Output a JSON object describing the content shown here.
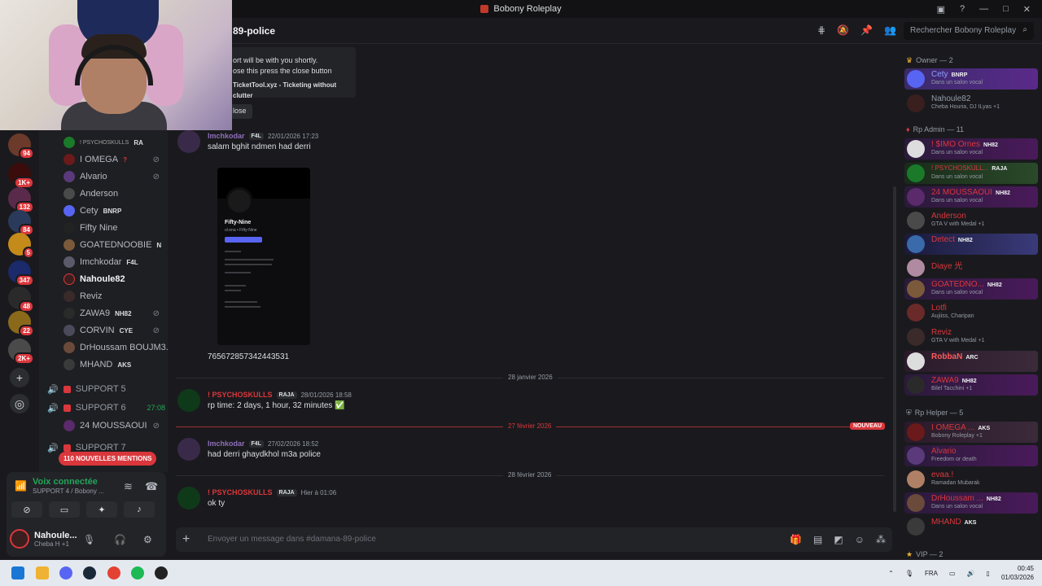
{
  "window": {
    "title": "Bobony Roleplay",
    "controls": [
      "—",
      "□",
      "✕"
    ]
  },
  "header": {
    "channel_name": "89-police",
    "search_placeholder": "Rechercher Bobony Roleplay"
  },
  "servers": {
    "badges": [
      "94",
      "1K+",
      "132",
      "84",
      "5",
      "347",
      "48",
      "22",
      "2K+"
    ]
  },
  "voice_users": [
    {
      "name": "! PSYCHOSKULLS",
      "color": "#a0a0a0",
      "tag": "RA"
    },
    {
      "name": "I OMEGA",
      "color": "#b5bac1",
      "tag": "?"
    },
    {
      "name": "Alvario",
      "color": "#b5bac1",
      "tag": ""
    },
    {
      "name": "Anderson",
      "color": "#b5bac1",
      "tag": ""
    },
    {
      "name": "Cety",
      "color": "#b5bac1",
      "tag": "BNRP"
    },
    {
      "name": "Fifty Nine",
      "color": "#b5bac1",
      "tag": ""
    },
    {
      "name": "GOATEDNOOBIE",
      "color": "#b5bac1",
      "tag": "N"
    },
    {
      "name": "Imchkodar",
      "color": "#b5bac1",
      "tag": "F4L"
    },
    {
      "name": "Nahoule82",
      "color": "#f2f3f5",
      "tag": ""
    },
    {
      "name": "Reviz",
      "color": "#b5bac1",
      "tag": ""
    },
    {
      "name": "ZAWA9",
      "color": "#b5bac1",
      "tag": "NH82"
    },
    {
      "name": "CORVIN",
      "color": "#b5bac1",
      "tag": "CYE"
    },
    {
      "name": "DrHoussam BOUJM3...",
      "color": "#b5bac1",
      "tag": ""
    },
    {
      "name": "MHAND",
      "color": "#b5bac1",
      "tag": "AKS"
    }
  ],
  "voice_channels": [
    {
      "name": "SUPPORT 5",
      "timer": ""
    },
    {
      "name": "SUPPORT 6",
      "timer": "27:08"
    },
    {
      "name": "SUPPORT 7",
      "timer": ""
    }
  ],
  "support6_user": "24 MOUSSAOUI",
  "mentions_label": "110 NOUVELLES MENTIONS",
  "voice_panel": {
    "title": "Voix connectée",
    "subtitle": "SUPPORT 4 / Bobony ...",
    "user_name": "Nahoule...",
    "user_status": "Cheba H +1"
  },
  "embed": {
    "line1": "ort will be with you shortly.",
    "line2": "ose this press the close button",
    "footer": "TicketTool.xyz - Ticketing without clutter",
    "close_label": "lose"
  },
  "messages": [
    {
      "author": "Imchkodar",
      "author_color": "#8e6fb8",
      "tag": "F4L",
      "time": "22/01/2026 17:23",
      "text": "salam bghit ndmen had derri"
    },
    {
      "author": "",
      "author_color": "#dbdee1",
      "tag": "",
      "time": "",
      "text": "765672857342443531"
    },
    {
      "author": "! PSYCHOSKULLS",
      "author_color": "#da373c",
      "tag": "RAJA",
      "time": "28/01/2026 18:58",
      "text": "rp time: 2 days, 1 hour, 32 minutes ✅"
    },
    {
      "author": "Imchkodar",
      "author_color": "#8e6fb8",
      "tag": "F4L",
      "time": "27/02/2026 18:52",
      "text": "had derri ghaydkhol m3a police"
    },
    {
      "author": "! PSYCHOSKULLS",
      "author_color": "#da373c",
      "tag": "RAJA",
      "time": "Hier à 01:06",
      "text": "ok ty"
    }
  ],
  "attachment": {
    "profile_name": "Fifty-Nine",
    "sub": "ol.ena • Fifty-Nine"
  },
  "dividers": [
    {
      "label": "28 janvier 2026",
      "new": false
    },
    {
      "label": "27 février 2026",
      "new": true
    },
    {
      "label": "28 février 2026",
      "new": false
    }
  ],
  "nouveau_label": "NOUVEAU",
  "composer_placeholder": "Envoyer un message dans #damana-89-police",
  "members": {
    "roles": [
      {
        "name": "Owner — 2"
      },
      {
        "name": "Rp Admin — 11"
      },
      {
        "name": "Rp Helper — 5"
      },
      {
        "name": "VIP — 2"
      }
    ],
    "owner": [
      {
        "name": "Cety",
        "tag": "BNRP",
        "status": "Dans un salon vocal",
        "color": "#5865f2"
      },
      {
        "name": "Nahoule82",
        "tag": "",
        "status": "Cheba Houria, DJ ILyas +1",
        "color": "#949ba4"
      }
    ],
    "admin": [
      {
        "name": "! $IMO Ornes",
        "tag": "NH82",
        "status": "Dans un salon vocal",
        "color": "#da373c"
      },
      {
        "name": "! PSYCHOSKULL...",
        "tag": "RAJA",
        "status": "Dans un salon vocal",
        "color": "#da373c"
      },
      {
        "name": "24 MOUSSAOUI",
        "tag": "NH82",
        "status": "Dans un salon vocal",
        "color": "#da373c"
      },
      {
        "name": "Anderson",
        "tag": "",
        "status": "GTA V with Medal +1",
        "color": "#da373c"
      },
      {
        "name": "Detect",
        "tag": "NH82",
        "status": "",
        "color": "#da373c"
      },
      {
        "name": "Diaye 光",
        "tag": "",
        "status": "",
        "color": "#da373c"
      },
      {
        "name": "GOATEDNO...",
        "tag": "NH82",
        "status": "Dans un salon vocal",
        "color": "#da373c"
      },
      {
        "name": "Lotfi",
        "tag": "",
        "status": "Aujiiss, Charipan",
        "color": "#da373c"
      },
      {
        "name": "Reviz",
        "tag": "",
        "status": "GTA V with Medal +1",
        "color": "#da373c"
      },
      {
        "name": "RobbaN",
        "tag": "ARC",
        "status": "",
        "color": "#ff5a5a"
      },
      {
        "name": "ZAWA9",
        "tag": "NH82",
        "status": "Bilel Tacchini +1",
        "color": "#da373c"
      }
    ],
    "helper": [
      {
        "name": "I OMEGA ...",
        "tag": "AKS",
        "status": "Bobony Roleplay +1",
        "color": "#da373c"
      },
      {
        "name": "Alvario",
        "tag": "",
        "status": "Freedom or death",
        "color": "#da373c"
      },
      {
        "name": "evaa.!",
        "tag": "",
        "status": "Ramadan Mubarak",
        "color": "#da373c"
      },
      {
        "name": "DrHoussam ...",
        "tag": "NH82",
        "status": "Dans un salon vocal",
        "color": "#da373c"
      },
      {
        "name": "MHAND",
        "tag": "AKS",
        "status": "",
        "color": "#da373c"
      }
    ]
  },
  "taskbar": {
    "lang": "FRA",
    "time": "00:45",
    "date": "01/03/2026"
  },
  "colors": {
    "accent": "#5865f2",
    "danger": "#da373c",
    "online": "#23a55a"
  }
}
